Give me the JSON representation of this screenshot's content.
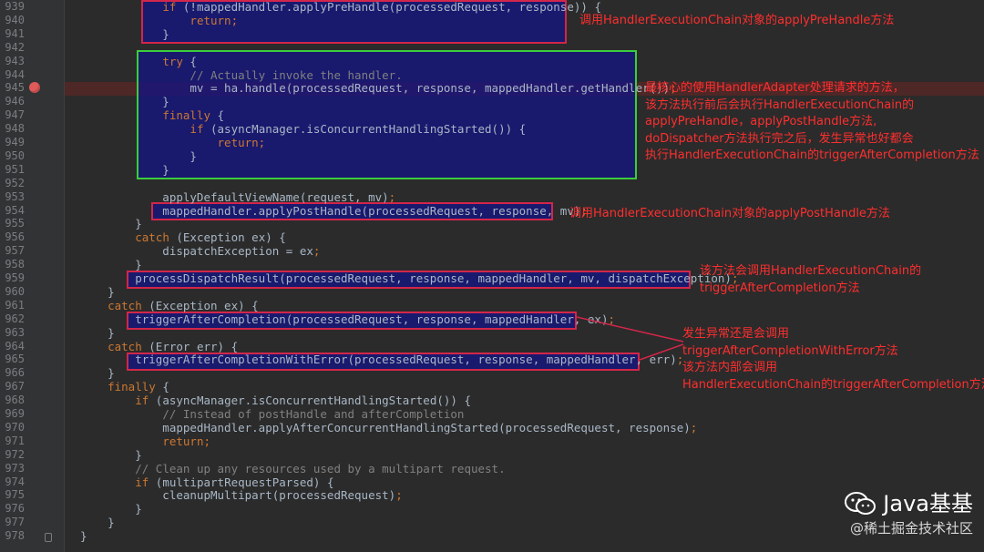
{
  "gutter": {
    "line_numbers": [
      "939",
      "940",
      "941",
      "942",
      "943",
      "944",
      "945",
      "946",
      "947",
      "948",
      "949",
      "950",
      "951",
      "952",
      "953",
      "954",
      "955",
      "956",
      "957",
      "958",
      "959",
      "960",
      "961",
      "962",
      "963",
      "964",
      "965",
      "966",
      "967",
      "968",
      "969",
      "970",
      "971",
      "972",
      "973",
      "974",
      "975",
      "976",
      "977",
      "978"
    ]
  },
  "code": {
    "lines": [
      "            if (!mappedHandler.applyPreHandle(processedRequest, response)) {",
      "                return;",
      "            }",
      "",
      "            try {",
      "                // Actually invoke the handler.",
      "                mv = ha.handle(processedRequest, response, mappedHandler.getHandler());",
      "            }",
      "            finally {",
      "                if (asyncManager.isConcurrentHandlingStarted()) {",
      "                    return;",
      "                }",
      "            }",
      "",
      "            applyDefaultViewName(request, mv);",
      "            mappedHandler.applyPostHandle(processedRequest, response, mv);",
      "        }",
      "        catch (Exception ex) {",
      "            dispatchException = ex;",
      "        }",
      "        processDispatchResult(processedRequest, response, mappedHandler, mv, dispatchException);",
      "    }",
      "    catch (Exception ex) {",
      "        triggerAfterCompletion(processedRequest, response, mappedHandler, ex);",
      "    }",
      "    catch (Error err) {",
      "        triggerAfterCompletionWithError(processedRequest, response, mappedHandler, err);",
      "    }",
      "    finally {",
      "        if (asyncManager.isConcurrentHandlingStarted()) {",
      "            // Instead of postHandle and afterCompletion",
      "            mappedHandler.applyAfterConcurrentHandlingStarted(processedRequest, response);",
      "            return;",
      "        }",
      "        // Clean up any resources used by a multipart request.",
      "        if (multipartRequestParsed) {",
      "            cleanupMultipart(processedRequest);",
      "        }",
      "    }",
      "}"
    ]
  },
  "annotations": {
    "pre_handle": "调用HandlerExecutionChain对象的applyPreHandle方法",
    "handle": "最核心的使用HandlerAdapter处理请求的方法，\n该方法执行前后会执行HandlerExecutionChain的\napplyPreHandle，applyPostHandle方法,\ndoDispatcher方法执行完之后，发生异常也好都会\n执行HandlerExecutionChain的triggerAfterCompletion方法",
    "post_handle": "调用HandlerExecutionChain对象的applyPostHandle方法",
    "dispatch_result": "该方法会调用HandlerExecutionChain的\ntriggerAfterCompletion方法",
    "error": "发生异常还是会调用\ntriggerAfterCompletionWithError方法\n该方法内部会调用\nHandlerExecutionChain的triggerAfterCompletion方法"
  },
  "watermark": {
    "title": "Java基基",
    "subtitle": "@稀土掘金技术社区"
  },
  "colors": {
    "background": "#2b2b2b",
    "keyword": "#cc7832",
    "comment": "#808080",
    "annotation_text": "#ff2e2e",
    "highlight_box_fill": "#14148c",
    "red_border": "#d2264a",
    "green_border": "#3ccd3c",
    "breakpoint": "#e05a5a"
  },
  "icons": {
    "breakpoint": "breakpoint-icon",
    "fold": "fold-marker-icon",
    "wechat": "wechat-icon"
  }
}
